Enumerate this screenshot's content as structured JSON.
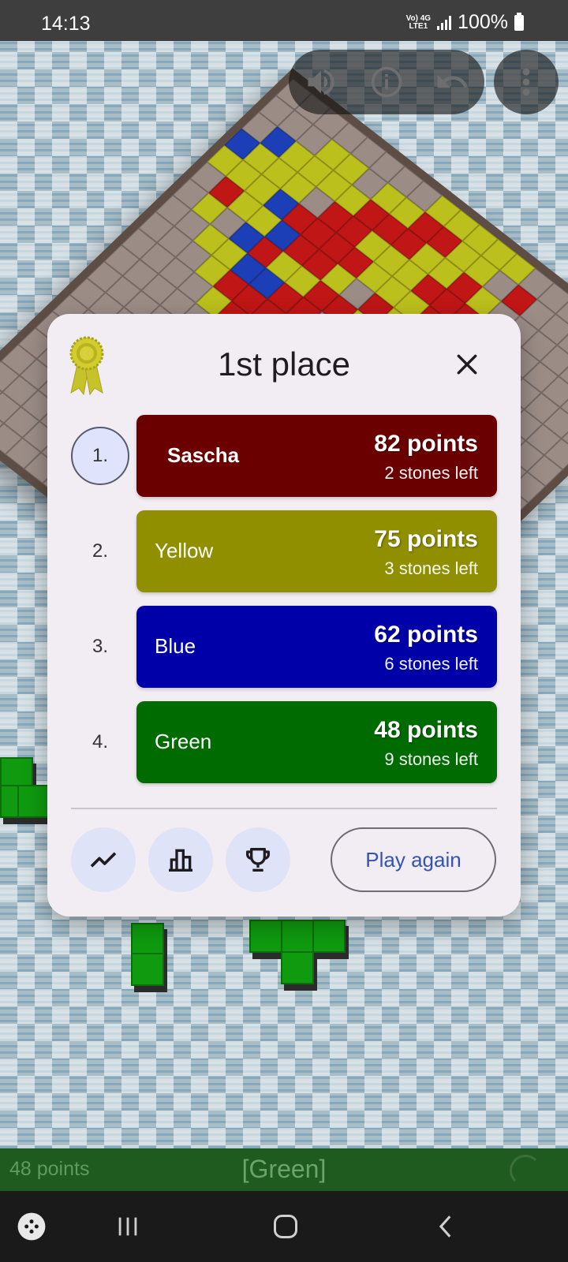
{
  "status_bar": {
    "time": "14:13",
    "network_line1": "Vo) 4G",
    "network_line2": "LTE1",
    "battery": "100%"
  },
  "toolbar": {
    "icons": [
      "volume-icon",
      "info-icon",
      "undo-icon",
      "more-vert-icon"
    ]
  },
  "dialog": {
    "title": "1st place",
    "icon": "ribbon-award-icon",
    "close_icon": "close-icon",
    "ranking": [
      {
        "rank": "1.",
        "name": "Sascha",
        "points": "82 points",
        "stones_left": "2 stones left",
        "color": "#6b0000"
      },
      {
        "rank": "2.",
        "name": "Yellow",
        "points": "75 points",
        "stones_left": "3 stones left",
        "color": "#8f8f00"
      },
      {
        "rank": "3.",
        "name": "Blue",
        "points": "62 points",
        "stones_left": "6 stones left",
        "color": "#0000a8"
      },
      {
        "rank": "4.",
        "name": "Green",
        "points": "48 points",
        "stones_left": "9 stones left",
        "color": "#006b00"
      }
    ],
    "buttons": {
      "chart_icon": "line-chart-icon",
      "stats_icon": "bar-chart-icon",
      "trophy_icon": "trophy-icon",
      "play_again": "Play again"
    }
  },
  "info_bar": {
    "points": "48 points",
    "current_player": "[Green]"
  },
  "nav_bar": {
    "icons": [
      "game-launcher-icon",
      "recent-apps-icon",
      "home-icon",
      "back-icon"
    ]
  }
}
